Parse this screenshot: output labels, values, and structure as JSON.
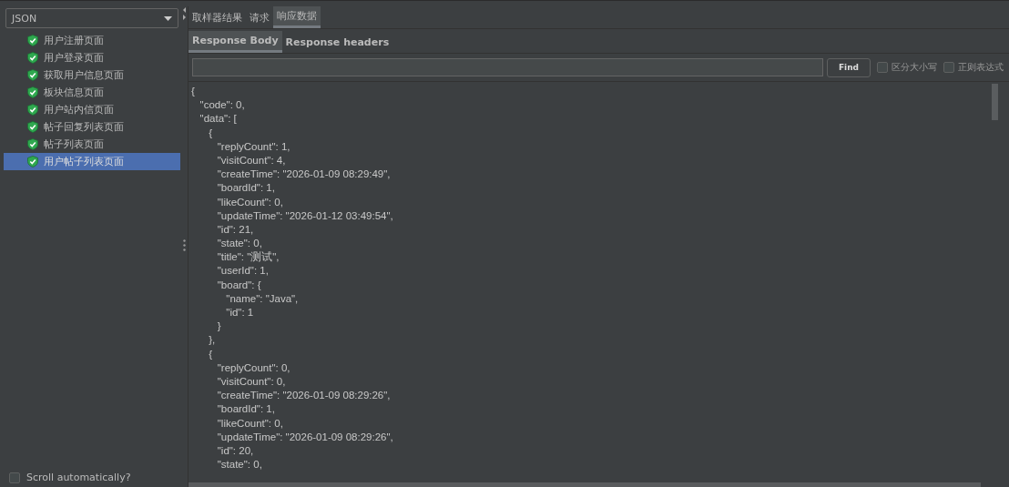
{
  "viewer": {
    "value": "JSON"
  },
  "tree": [
    {
      "label": "用户注册页面",
      "selected": false
    },
    {
      "label": "用户登录页面",
      "selected": false
    },
    {
      "label": "获取用户信息页面",
      "selected": false
    },
    {
      "label": "板块信息页面",
      "selected": false
    },
    {
      "label": "用户站内信页面",
      "selected": false
    },
    {
      "label": "帖子回复列表页面",
      "selected": false
    },
    {
      "label": "帖子列表页面",
      "selected": false
    },
    {
      "label": "用户帖子列表页面",
      "selected": true
    }
  ],
  "scroll_automatically": {
    "label": "Scroll automatically?",
    "checked": false
  },
  "tabs": [
    {
      "label": "取样器结果",
      "selected": false
    },
    {
      "label": "请求",
      "selected": false
    },
    {
      "label": "响应数据",
      "selected": true
    }
  ],
  "subtabs": [
    {
      "label": "Response Body",
      "selected": true
    },
    {
      "label": "Response headers",
      "selected": false
    }
  ],
  "find_button": "Find",
  "options": [
    {
      "label": "区分大小写",
      "checked": false
    },
    {
      "label": "正则表达式",
      "checked": false
    }
  ],
  "response_lines": [
    "{",
    "   \"code\": 0,",
    "   \"data\": [",
    "      {",
    "         \"replyCount\": 1,",
    "         \"visitCount\": 4,",
    "         \"createTime\": \"2026-01-09 08:29:49\",",
    "         \"boardId\": 1,",
    "         \"likeCount\": 0,",
    "         \"updateTime\": \"2026-01-12 03:49:54\",",
    "         \"id\": 21,",
    "         \"state\": 0,",
    "         \"title\": \"测试\",",
    "         \"userId\": 1,",
    "         \"board\": {",
    "            \"name\": \"Java\",",
    "            \"id\": 1",
    "         }",
    "      },",
    "      {",
    "         \"replyCount\": 0,",
    "         \"visitCount\": 0,",
    "         \"createTime\": \"2026-01-09 08:29:26\",",
    "         \"boardId\": 1,",
    "         \"likeCount\": 0,",
    "         \"updateTime\": \"2026-01-09 08:29:26\",",
    "         \"id\": 20,",
    "         \"state\": 0,"
  ]
}
